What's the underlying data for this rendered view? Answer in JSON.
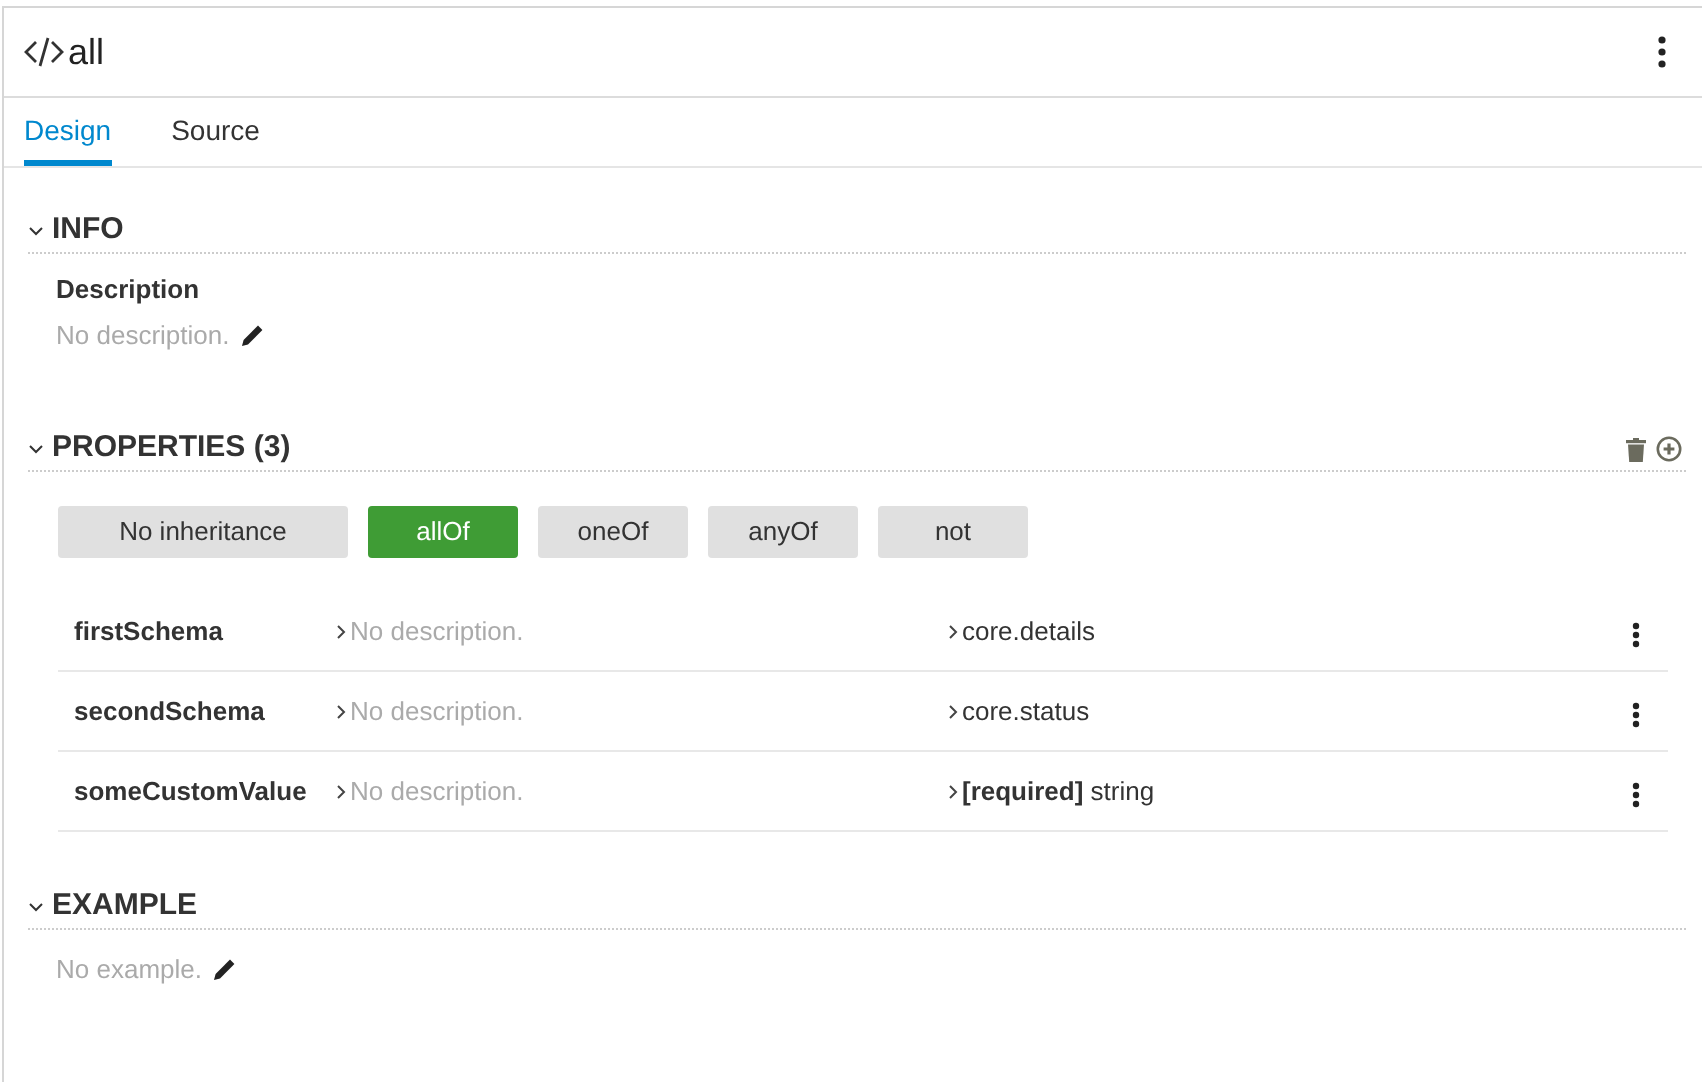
{
  "header": {
    "title": "all"
  },
  "tabs": [
    {
      "label": "Design",
      "selected": true
    },
    {
      "label": "Source",
      "selected": false
    }
  ],
  "info": {
    "heading": "INFO",
    "expanded": true,
    "description_label": "Description",
    "description": "No description."
  },
  "properties": {
    "heading": "PROPERTIES (3)",
    "expanded": true,
    "inheritance": [
      {
        "label": "No inheritance",
        "selected": false
      },
      {
        "label": "allOf",
        "selected": true
      },
      {
        "label": "oneOf",
        "selected": false
      },
      {
        "label": "anyOf",
        "selected": false
      },
      {
        "label": "not",
        "selected": false
      }
    ],
    "rows": [
      {
        "name": "firstSchema",
        "description": "No description.",
        "type": "core.details"
      },
      {
        "name": "secondSchema",
        "description": "No description.",
        "type": "core.status"
      },
      {
        "name": "someCustomValue",
        "description": "No description.",
        "type": "**[required]** string"
      }
    ]
  },
  "example": {
    "heading": "EXAMPLE",
    "expanded": true,
    "text": "No example."
  }
}
